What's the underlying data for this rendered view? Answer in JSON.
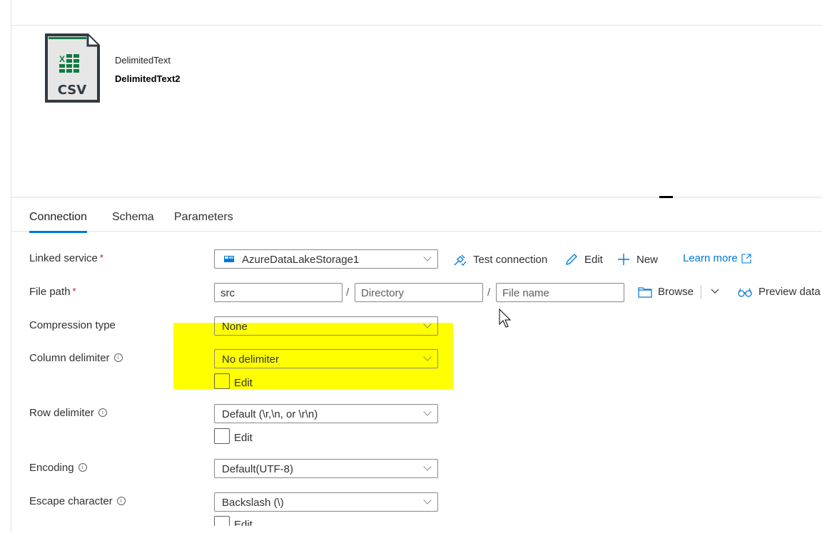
{
  "dataset": {
    "icon": "csv-file-icon",
    "icon_text": "CSV",
    "type": "DelimitedText",
    "name": "DelimitedText2"
  },
  "tabs": [
    {
      "label": "Connection",
      "active": true
    },
    {
      "label": "Schema",
      "active": false
    },
    {
      "label": "Parameters",
      "active": false
    }
  ],
  "form": {
    "linked_service": {
      "label": "Linked service",
      "required": "*",
      "value": "AzureDataLakeStorage1",
      "actions": {
        "test_connection": "Test connection",
        "edit": "Edit",
        "new": "New",
        "learn_more": "Learn more"
      }
    },
    "file_path": {
      "label": "File path",
      "required": "*",
      "container": "src",
      "directory_placeholder": "Directory",
      "file_placeholder": "File name",
      "separator": "/",
      "browse": "Browse",
      "preview": "Preview data"
    },
    "compression_type": {
      "label": "Compression type",
      "value": "None"
    },
    "column_delimiter": {
      "label": "Column delimiter",
      "value": "No delimiter",
      "edit_label": "Edit",
      "edit_checked": false
    },
    "row_delimiter": {
      "label": "Row delimiter",
      "value": "Default (\\r,\\n, or \\r\\n)",
      "edit_label": "Edit",
      "edit_checked": false
    },
    "encoding": {
      "label": "Encoding",
      "value": "Default(UTF-8)"
    },
    "escape_character": {
      "label": "Escape character",
      "value": "Backslash (\\)",
      "edit_label": "Edit",
      "edit_checked": false
    }
  },
  "colors": {
    "accent": "#0078d4",
    "required": "#a4262c",
    "highlight": "#ffff00",
    "csv_green": "#107c41"
  }
}
